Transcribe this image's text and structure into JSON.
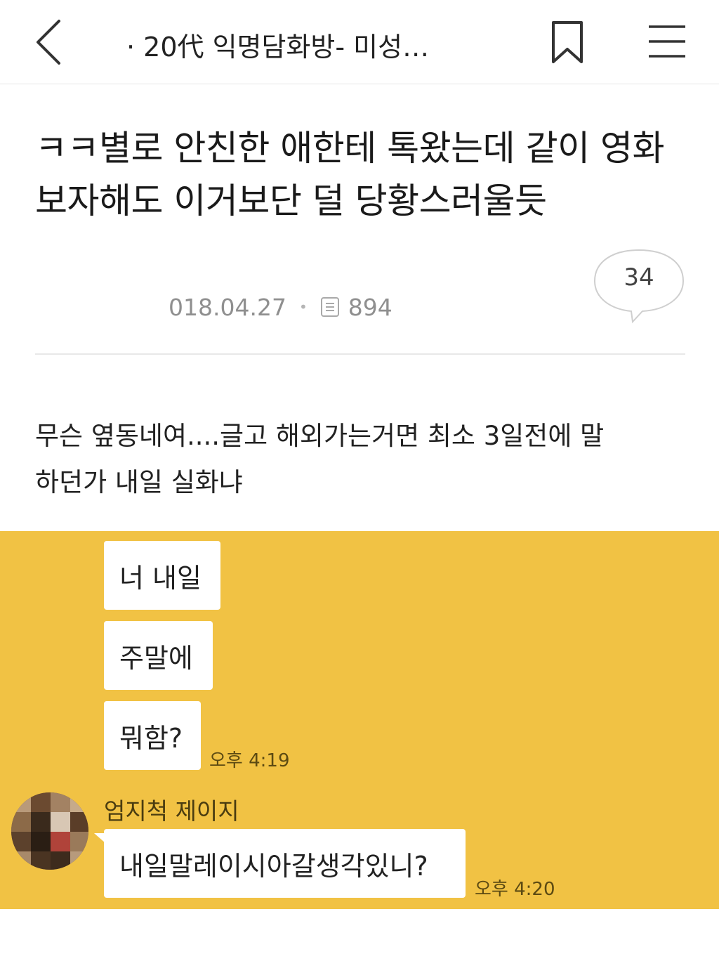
{
  "header": {
    "board_title": "· 20代 익명담화방- 미성…",
    "icons": [
      "back-icon",
      "bookmark-icon",
      "menu-icon"
    ]
  },
  "post": {
    "title_line1": "ㅋㅋ별로 안친한 애한테 톡왔는데 같이 영화",
    "title_line2": "보자해도 이거보단 덜 당황스러울듯",
    "date": "018.04.27",
    "views": "894",
    "comment_count": "34",
    "body_line1": "무슨 옆동네여....글고 해외가는거면 최소 3일전에 말",
    "body_line2": "하던가 내일 실화냐"
  },
  "chat": {
    "background_color": "#f1c244",
    "messages_sent": [
      {
        "text": "너 내일"
      },
      {
        "text": "주말에"
      },
      {
        "text": "뭐함?"
      }
    ],
    "sent_time": "오후 4:19",
    "received": {
      "sender_name": "엄지척 제이지",
      "text": "내일말레이시아갈생각있니?",
      "time": "오후 4:20"
    }
  }
}
